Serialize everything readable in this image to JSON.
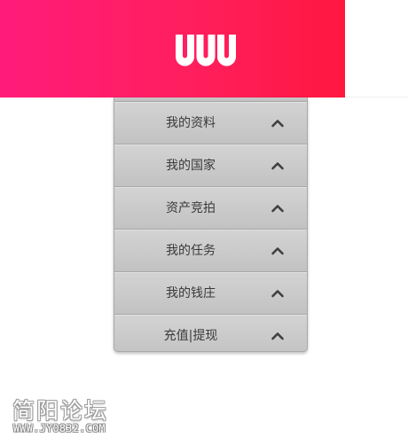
{
  "header": {
    "logo_icon": "uuu-logo",
    "accent_colors": [
      "#ff1b7a",
      "#ff1740"
    ]
  },
  "menu": {
    "items": [
      {
        "label": "我的资料",
        "icon": "chevron-up-icon"
      },
      {
        "label": "我的国家",
        "icon": "chevron-up-icon"
      },
      {
        "label": "资产竞拍",
        "icon": "chevron-up-icon"
      },
      {
        "label": "我的任务",
        "icon": "chevron-up-icon"
      },
      {
        "label": "我的钱庄",
        "icon": "chevron-up-icon"
      },
      {
        "label": "充值|提现",
        "icon": "chevron-up-icon"
      }
    ]
  },
  "watermark": {
    "title": "简阳论坛",
    "url": "WWW.JY0832.COM"
  }
}
